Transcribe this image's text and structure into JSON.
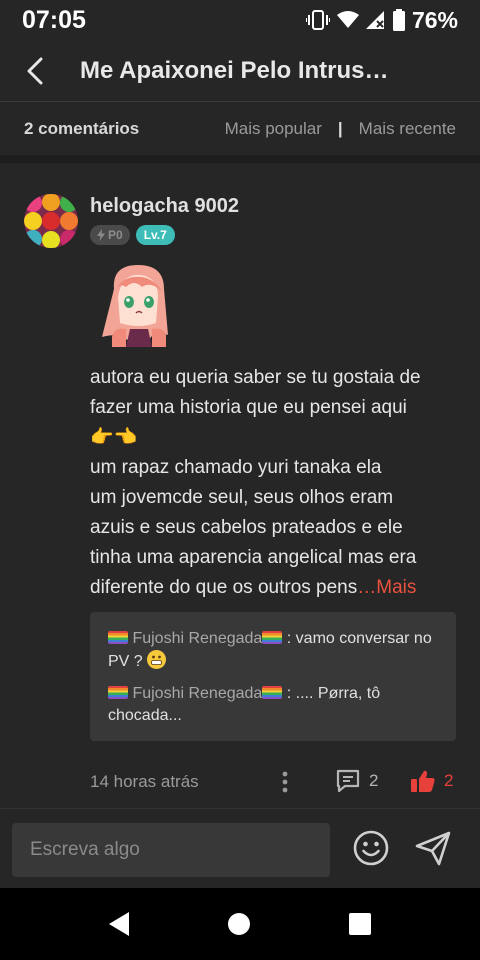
{
  "status_bar": {
    "time": "07:05",
    "battery": "76%"
  },
  "header": {
    "title": "Me Apaixonei Pelo Intrus…",
    "back_icon": "chevron-left-icon"
  },
  "sort_bar": {
    "count": "2 comentários",
    "option_popular": "Mais popular",
    "separator": "|",
    "option_recent": "Mais recente"
  },
  "comment": {
    "username": "helogacha 9002",
    "badge_points": "P0",
    "badge_level": "Lv.7",
    "text_lines": [
      "autora eu queria saber se tu gostaia de",
      "fazer uma historia que eu pensei aqui",
      "👉👈",
      "um rapaz chamado yuri tanaka ela",
      "um jovemcde seul, seus olhos eram",
      "azuis e seus cabelos prateados e ele",
      "tinha uma aparencia angelical mas era",
      "diferente do que os outros pens"
    ],
    "more_link": "…Mais",
    "replies": [
      {
        "name": "Fujoshi Renegada",
        "text": " : vamo conversar no PV ? "
      },
      {
        "name": "Fujoshi Renegada",
        "text": " : .... Pørra, tô chocada..."
      }
    ],
    "time_ago": "14 horas atrás",
    "reply_count": "2",
    "like_count": "2"
  },
  "composer": {
    "placeholder": "Escreva algo"
  },
  "colors": {
    "accent": "#e8523f",
    "level_badge": "#3ebdb8",
    "background": "#262626"
  }
}
